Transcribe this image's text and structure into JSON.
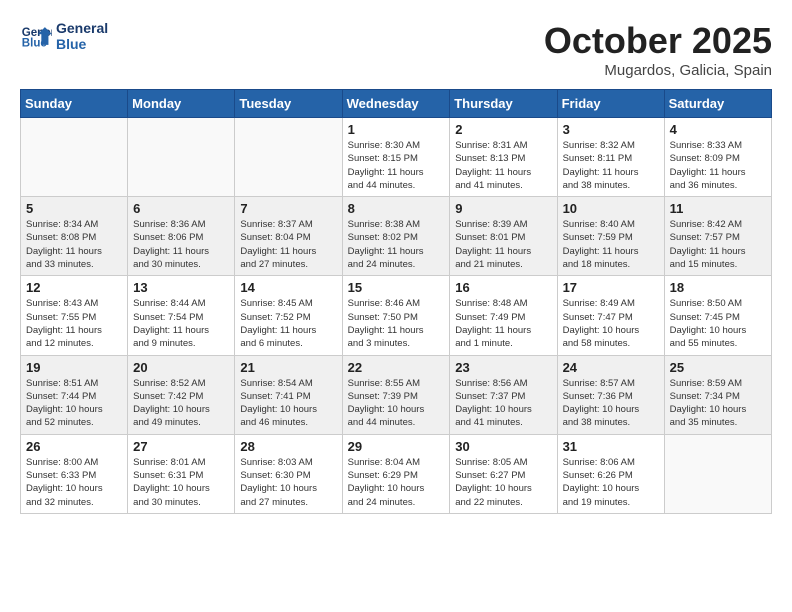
{
  "header": {
    "logo_line1": "General",
    "logo_line2": "Blue",
    "month": "October 2025",
    "location": "Mugardos, Galicia, Spain"
  },
  "weekdays": [
    "Sunday",
    "Monday",
    "Tuesday",
    "Wednesday",
    "Thursday",
    "Friday",
    "Saturday"
  ],
  "weeks": [
    [
      {
        "day": "",
        "info": ""
      },
      {
        "day": "",
        "info": ""
      },
      {
        "day": "",
        "info": ""
      },
      {
        "day": "1",
        "info": "Sunrise: 8:30 AM\nSunset: 8:15 PM\nDaylight: 11 hours\nand 44 minutes."
      },
      {
        "day": "2",
        "info": "Sunrise: 8:31 AM\nSunset: 8:13 PM\nDaylight: 11 hours\nand 41 minutes."
      },
      {
        "day": "3",
        "info": "Sunrise: 8:32 AM\nSunset: 8:11 PM\nDaylight: 11 hours\nand 38 minutes."
      },
      {
        "day": "4",
        "info": "Sunrise: 8:33 AM\nSunset: 8:09 PM\nDaylight: 11 hours\nand 36 minutes."
      }
    ],
    [
      {
        "day": "5",
        "info": "Sunrise: 8:34 AM\nSunset: 8:08 PM\nDaylight: 11 hours\nand 33 minutes."
      },
      {
        "day": "6",
        "info": "Sunrise: 8:36 AM\nSunset: 8:06 PM\nDaylight: 11 hours\nand 30 minutes."
      },
      {
        "day": "7",
        "info": "Sunrise: 8:37 AM\nSunset: 8:04 PM\nDaylight: 11 hours\nand 27 minutes."
      },
      {
        "day": "8",
        "info": "Sunrise: 8:38 AM\nSunset: 8:02 PM\nDaylight: 11 hours\nand 24 minutes."
      },
      {
        "day": "9",
        "info": "Sunrise: 8:39 AM\nSunset: 8:01 PM\nDaylight: 11 hours\nand 21 minutes."
      },
      {
        "day": "10",
        "info": "Sunrise: 8:40 AM\nSunset: 7:59 PM\nDaylight: 11 hours\nand 18 minutes."
      },
      {
        "day": "11",
        "info": "Sunrise: 8:42 AM\nSunset: 7:57 PM\nDaylight: 11 hours\nand 15 minutes."
      }
    ],
    [
      {
        "day": "12",
        "info": "Sunrise: 8:43 AM\nSunset: 7:55 PM\nDaylight: 11 hours\nand 12 minutes."
      },
      {
        "day": "13",
        "info": "Sunrise: 8:44 AM\nSunset: 7:54 PM\nDaylight: 11 hours\nand 9 minutes."
      },
      {
        "day": "14",
        "info": "Sunrise: 8:45 AM\nSunset: 7:52 PM\nDaylight: 11 hours\nand 6 minutes."
      },
      {
        "day": "15",
        "info": "Sunrise: 8:46 AM\nSunset: 7:50 PM\nDaylight: 11 hours\nand 3 minutes."
      },
      {
        "day": "16",
        "info": "Sunrise: 8:48 AM\nSunset: 7:49 PM\nDaylight: 11 hours\nand 1 minute."
      },
      {
        "day": "17",
        "info": "Sunrise: 8:49 AM\nSunset: 7:47 PM\nDaylight: 10 hours\nand 58 minutes."
      },
      {
        "day": "18",
        "info": "Sunrise: 8:50 AM\nSunset: 7:45 PM\nDaylight: 10 hours\nand 55 minutes."
      }
    ],
    [
      {
        "day": "19",
        "info": "Sunrise: 8:51 AM\nSunset: 7:44 PM\nDaylight: 10 hours\nand 52 minutes."
      },
      {
        "day": "20",
        "info": "Sunrise: 8:52 AM\nSunset: 7:42 PM\nDaylight: 10 hours\nand 49 minutes."
      },
      {
        "day": "21",
        "info": "Sunrise: 8:54 AM\nSunset: 7:41 PM\nDaylight: 10 hours\nand 46 minutes."
      },
      {
        "day": "22",
        "info": "Sunrise: 8:55 AM\nSunset: 7:39 PM\nDaylight: 10 hours\nand 44 minutes."
      },
      {
        "day": "23",
        "info": "Sunrise: 8:56 AM\nSunset: 7:37 PM\nDaylight: 10 hours\nand 41 minutes."
      },
      {
        "day": "24",
        "info": "Sunrise: 8:57 AM\nSunset: 7:36 PM\nDaylight: 10 hours\nand 38 minutes."
      },
      {
        "day": "25",
        "info": "Sunrise: 8:59 AM\nSunset: 7:34 PM\nDaylight: 10 hours\nand 35 minutes."
      }
    ],
    [
      {
        "day": "26",
        "info": "Sunrise: 8:00 AM\nSunset: 6:33 PM\nDaylight: 10 hours\nand 32 minutes."
      },
      {
        "day": "27",
        "info": "Sunrise: 8:01 AM\nSunset: 6:31 PM\nDaylight: 10 hours\nand 30 minutes."
      },
      {
        "day": "28",
        "info": "Sunrise: 8:03 AM\nSunset: 6:30 PM\nDaylight: 10 hours\nand 27 minutes."
      },
      {
        "day": "29",
        "info": "Sunrise: 8:04 AM\nSunset: 6:29 PM\nDaylight: 10 hours\nand 24 minutes."
      },
      {
        "day": "30",
        "info": "Sunrise: 8:05 AM\nSunset: 6:27 PM\nDaylight: 10 hours\nand 22 minutes."
      },
      {
        "day": "31",
        "info": "Sunrise: 8:06 AM\nSunset: 6:26 PM\nDaylight: 10 hours\nand 19 minutes."
      },
      {
        "day": "",
        "info": ""
      }
    ]
  ]
}
